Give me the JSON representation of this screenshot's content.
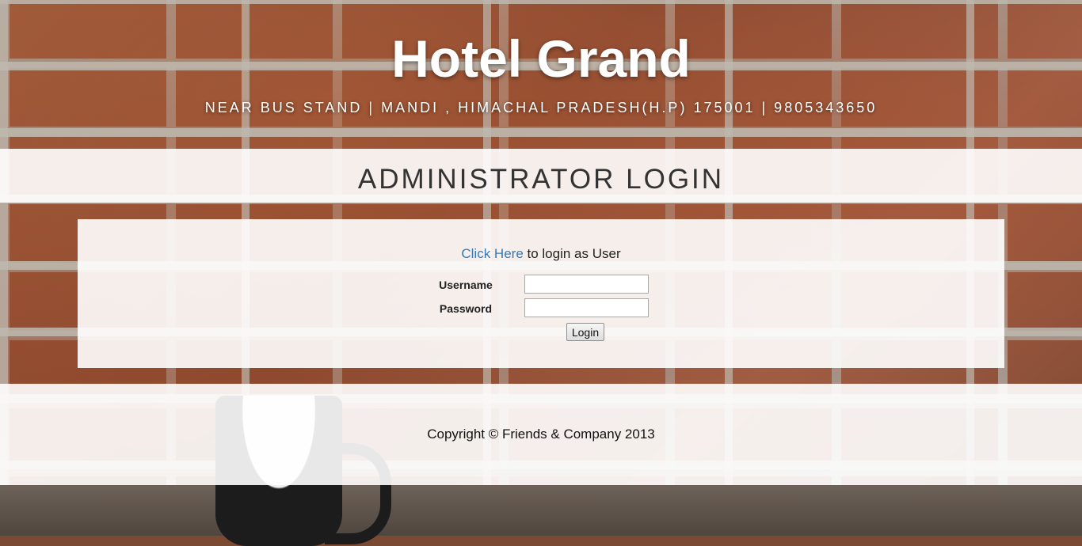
{
  "header": {
    "title": "Hotel Grand",
    "subtitle": "NEAR BUS STAND | MANDI , HIMACHAL PRADESH(H.P) 175001 | 9805343650"
  },
  "login": {
    "heading": "ADMINISTRATOR LOGIN",
    "switch_link": "Click Here",
    "switch_text": " to login as User",
    "username_label": "Username",
    "password_label": "Password",
    "username_value": "",
    "password_value": "",
    "submit_label": "Login"
  },
  "footer": {
    "copyright": "Copyright © Friends & Company 2013"
  },
  "colors": {
    "link": "#337ab7",
    "panel": "#ffffff",
    "heading_text": "#333333"
  }
}
